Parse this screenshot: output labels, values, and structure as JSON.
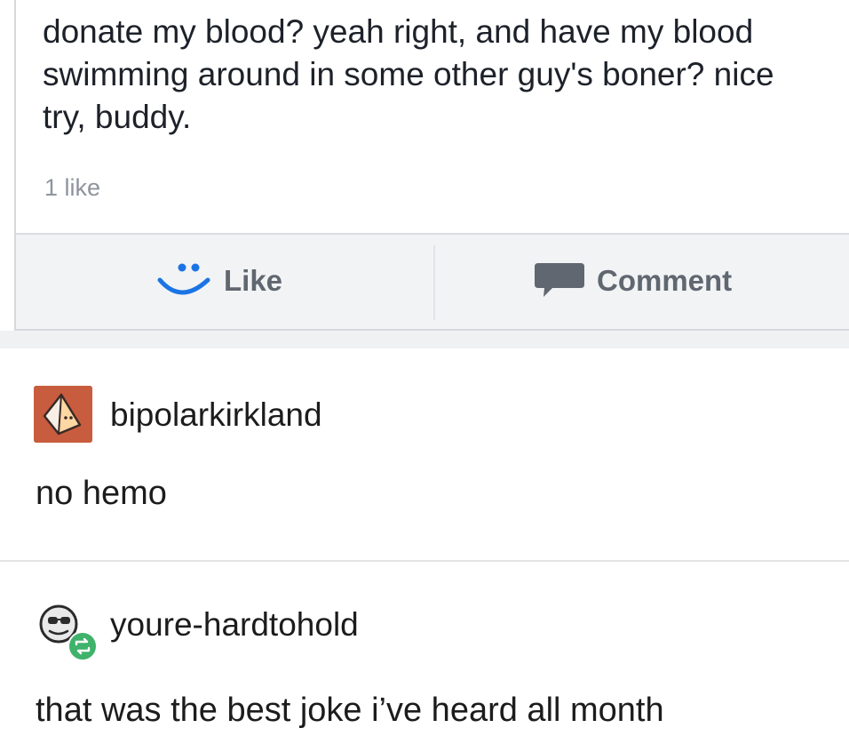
{
  "post": {
    "text": "donate my blood? yeah right, and have my blood swimming around in some other guy's boner? nice try, buddy.",
    "like_count": "1 like",
    "actions": {
      "like_label": "Like",
      "comment_label": "Comment"
    }
  },
  "replies": [
    {
      "username": "bipolarkirkland",
      "avatar_icon": "pyramid-avatar-icon",
      "avatar_color": "#c85c3e",
      "text": "no hemo"
    },
    {
      "username": "youre-hardtohold",
      "avatar_icon": "sunglasses-avatar-icon",
      "badge_icon": "reblog-badge-icon",
      "badge_color": "#3fb26b",
      "text": "that was the best joke i’ve heard all month"
    }
  ],
  "colors": {
    "like_icon": "#1b74e4",
    "comment_icon": "#606770",
    "action_text": "#606770",
    "action_bar_bg": "#f2f3f5"
  }
}
